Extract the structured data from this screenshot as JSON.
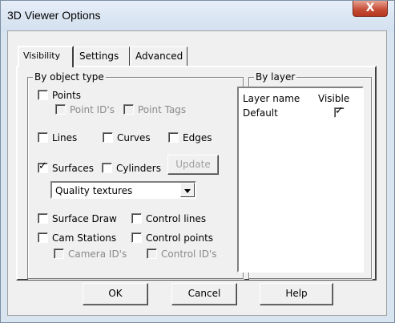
{
  "window": {
    "title": "3D Viewer Options",
    "close_label": "X"
  },
  "tabs": [
    {
      "label": "Visibility"
    },
    {
      "label": "Settings"
    },
    {
      "label": "Advanced"
    }
  ],
  "by_object_type": {
    "legend": "By object type",
    "points": {
      "label": "Points",
      "checked": false
    },
    "point_ids": {
      "label": "Point ID's",
      "checked": false,
      "enabled": false
    },
    "point_tags": {
      "label": "Point Tags",
      "checked": false,
      "enabled": false
    },
    "lines": {
      "label": "Lines",
      "checked": false
    },
    "curves": {
      "label": "Curves",
      "checked": false
    },
    "edges": {
      "label": "Edges",
      "checked": false
    },
    "surfaces": {
      "label": "Surfaces",
      "checked": true
    },
    "cylinders": {
      "label": "Cylinders",
      "checked": false
    },
    "update_button": "Update",
    "texture_combo": {
      "selected": "Quality textures"
    },
    "surface_draw": {
      "label": "Surface Draw",
      "checked": false
    },
    "control_lines": {
      "label": "Control lines",
      "checked": false
    },
    "cam_stations": {
      "label": "Cam Stations",
      "checked": false
    },
    "control_points": {
      "label": "Control points",
      "checked": false
    },
    "camera_ids": {
      "label": "Camera ID's",
      "checked": false,
      "enabled": false
    },
    "control_ids": {
      "label": "Control ID's",
      "checked": false,
      "enabled": false
    }
  },
  "by_layer": {
    "legend": "By layer",
    "columns": [
      "Layer name",
      "Visible"
    ],
    "rows": [
      {
        "name": "Default",
        "visible": true
      }
    ]
  },
  "buttons": {
    "ok": "OK",
    "cancel": "Cancel",
    "help": "Help"
  },
  "icons": {
    "check": "✓",
    "dropdown": "chevron-down-icon",
    "close": "close-icon"
  }
}
